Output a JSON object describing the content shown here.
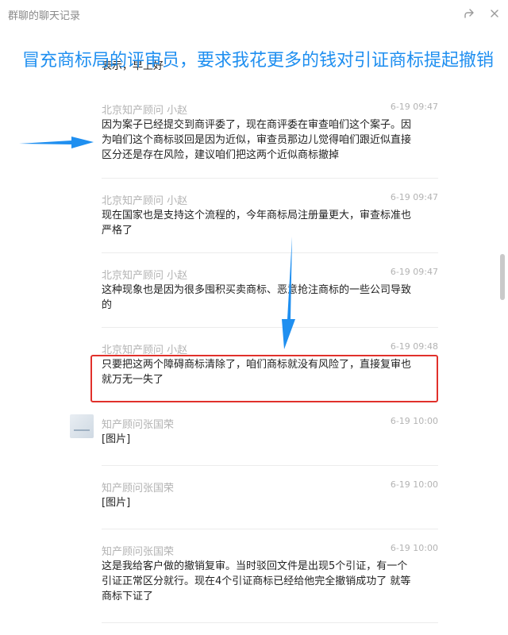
{
  "window": {
    "title": "群聊的聊天记录",
    "share_icon": "share-icon",
    "close_icon": "close-icon"
  },
  "annotation": {
    "text": "冒充商标局的评审员，要求我花更多的钱对引证商标提起撤销",
    "color": "#1f8ff0"
  },
  "partial_prev_message": "表示，早上好",
  "messages": [
    {
      "sender": "北京知产顾问 小赵",
      "time": "6-19 09:47",
      "text": "因为案子已经提交到商评委了，现在商评委在审查咱们这个案子。因为咱们这个商标驳回是因为近似，审查员那边儿觉得咱们跟近似直接区分还是存在风险，建议咱们把这两个近似商标撤掉"
    },
    {
      "sender": "北京知产顾问 小赵",
      "time": "6-19 09:47",
      "text": "现在国家也是支持这个流程的，今年商标局注册量更大，审查标准也严格了"
    },
    {
      "sender": "北京知产顾问 小赵",
      "time": "6-19 09:47",
      "text": "这种现象也是因为很多囤积买卖商标、恶意抢注商标的一些公司导致的"
    },
    {
      "sender": "北京知产顾问 小赵",
      "time": "6-19 09:48",
      "text": "只要把这两个障碍商标清除了，咱们商标就没有风险了，直接复审也就万无一失了"
    },
    {
      "sender": "知产顾问张国荣",
      "time": "6-19 10:00",
      "text": "[图片]"
    },
    {
      "sender": "知产顾问张国荣",
      "time": "6-19 10:00",
      "text": "[图片]"
    },
    {
      "sender": "知产顾问张国荣",
      "time": "6-19 10:00",
      "text": "这是我给客户做的撤销复审。当时驳回文件是出现5个引证，有一个引证正常区分就行。现在4个引证商标已经给他完全撤销成功了 就等商标下证了"
    }
  ],
  "colors": {
    "highlight_border": "#e1312b",
    "arrow": "#1f8ff0"
  }
}
